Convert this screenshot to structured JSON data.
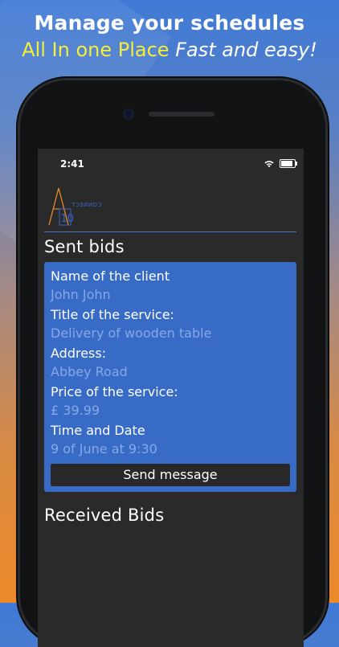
{
  "promo": {
    "headline": "Manage your schedules",
    "tagline_colored": "All In one Place",
    "tagline_italic": "Fast and easy!"
  },
  "status_bar": {
    "time": "2:41",
    "icons": [
      "wifi-icon",
      "battery-icon"
    ]
  },
  "app": {
    "logo": {
      "letter_a": "A",
      "digits": "10",
      "text": "CONNECT"
    },
    "sent_section_title": "Sent bids",
    "received_section_title": "Received Bids",
    "bid": {
      "client_label": "Name of the client",
      "client_value": "John John",
      "service_label": "Title of the service:",
      "service_value": "Delivery of wooden table",
      "address_label": "Address:",
      "address_value": "Abbey Road",
      "price_label": "Price of the service:",
      "price_value": "£ 39.99",
      "datetime_label": "Time and Date",
      "datetime_value": "9 of June at 9:30",
      "send_button_label": "Send message"
    }
  },
  "colors": {
    "card": "#386bc6",
    "value_text": "#86a8e6",
    "screen_bg": "#2a2a2a",
    "accent_yellow": "#f4ef3a",
    "logo_orange": "#e58a2c",
    "logo_blue": "#3a63c8"
  }
}
